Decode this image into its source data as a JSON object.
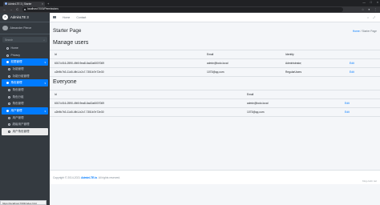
{
  "browser": {
    "tab_title": "AdminLTE 3 | Starter",
    "url": "localhost:7003/Permissions",
    "new_tab": "+",
    "tab_close": "×",
    "controls": [
      "—",
      "□",
      "×"
    ],
    "nav_buttons": [
      "←",
      "→",
      "C"
    ]
  },
  "sidebar": {
    "brand": "AdminLTE 3",
    "brand_logo": "A",
    "user_name": "Alexander Pierce",
    "search_placeholder": "Search",
    "items": [
      {
        "label": "Home",
        "type": "item"
      },
      {
        "label": "Privacy",
        "type": "item"
      },
      {
        "label": "权限管理",
        "type": "section"
      },
      {
        "label": "功能管理",
        "type": "sub"
      },
      {
        "label": "功能分组管理",
        "type": "sub"
      },
      {
        "label": "角色管理",
        "type": "section"
      },
      {
        "label": "角色管理",
        "type": "sub"
      },
      {
        "label": "角色分组",
        "type": "sub"
      },
      {
        "label": "角色管理",
        "type": "sub"
      },
      {
        "label": "用户管理",
        "type": "section"
      },
      {
        "label": "用户管理",
        "type": "sub"
      },
      {
        "label": "超级用户管理",
        "type": "sub"
      },
      {
        "label": "用户角色管理",
        "type": "active"
      }
    ],
    "status_url": "https://localhost:7003/index.html"
  },
  "topnav": {
    "links": [
      "Home",
      "Contact"
    ]
  },
  "page": {
    "title": "Starter Page",
    "breadcrumb_home": "Home",
    "breadcrumb_sep": "/",
    "breadcrumb_current": "Starter Page"
  },
  "manage_users": {
    "heading": "Manage users",
    "columns": [
      "Id",
      "Email",
      "Identity",
      ""
    ],
    "rows": [
      {
        "id": "6017c016-2590-4fb9-9ea8-6a42a6007069",
        "email": "admin@todo.local",
        "identity": "Administrator;",
        "action": "Edit"
      },
      {
        "id": "c2b9b7b3-11d0-4fb1-b2c7-7351b7e72e30",
        "email": "1073@qq.com",
        "identity": "RegularUsers",
        "action": "Edit"
      }
    ]
  },
  "everyone": {
    "heading": "Everyone",
    "columns": [
      "Id",
      "Email",
      ""
    ],
    "rows": [
      {
        "id": "6017c016-2590-4fb9-9ea8-6a42a6007069",
        "email": "admin@todo.local",
        "action": "Edit"
      },
      {
        "id": "c2b9b7b3-11d0-4fb1-b2c7-7351b7e72e30",
        "email": "1073@qq.com",
        "action": "Edit"
      }
    ]
  },
  "footer": {
    "prefix": "Copyright © 2014-2021 ",
    "brand": "AdminLTE.io",
    "suffix": ". All rights reserved."
  },
  "watermark": "blog.csdn.net"
}
